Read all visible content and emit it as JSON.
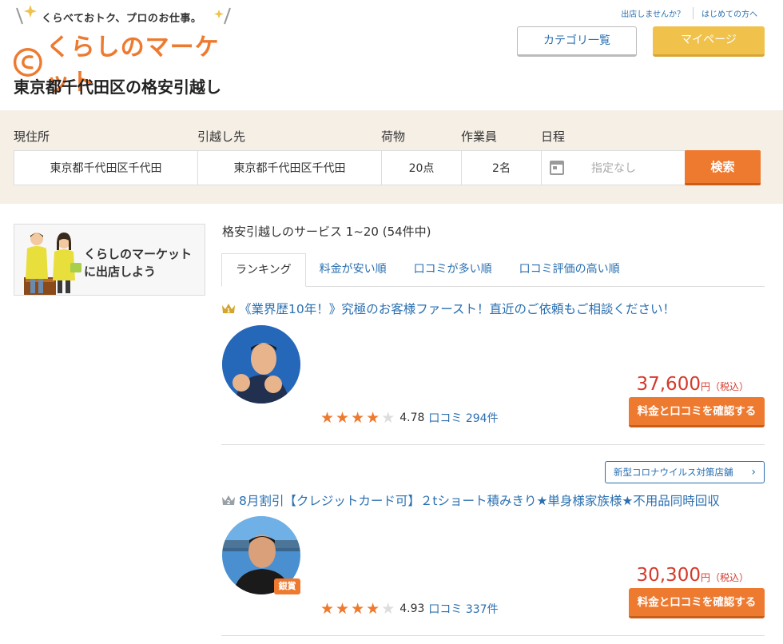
{
  "header": {
    "tagline": "くらべておトク、プロのお仕事。",
    "logo_text": "くらしのマーケット",
    "links": [
      "出店しませんか？",
      "はじめての方へ"
    ],
    "category_button": "カテゴリ一覧",
    "mypage_button": "マイページ",
    "page_title": "東京都千代田区の格安引越し",
    "brand_color": "#ee7a30"
  },
  "search": {
    "from_label": "現住所",
    "from_value": "東京都千代田区千代田",
    "to_label": "引越し先",
    "to_value": "東京都千代田区千代田",
    "items_label": "荷物",
    "items_value": "20点",
    "staff_label": "作業員",
    "staff_value": "2名",
    "date_label": "日程",
    "date_placeholder": "指定なし",
    "search_button": "検索"
  },
  "sidebar": {
    "banner_line1": "くらしのマーケット",
    "banner_line2": "に出店しよう"
  },
  "main": {
    "result_count": "格安引越しのサービス 1~20 (54件中)",
    "tabs": [
      "ランキング",
      "料金が安い順",
      "口コミが多い順",
      "口コミ評価の高い順"
    ],
    "listings": [
      {
        "title": "《業界歴10年！》究極のお客様ファースト！直近のご依頼もご相談ください！",
        "price": "37,600",
        "yen": "円",
        "tax": "（税込）",
        "button": "料金と口コミを確認する",
        "rating": 4.78,
        "score": "4.78",
        "reviews_label": "口コミ 294件"
      },
      {
        "covid_badge": "新型コロナウイルス対策店舗",
        "title": "8月割引【クレジットカード可】２tショート積みきり★単身様家族様★不用品同時回収",
        "award": "銀賞",
        "price": "30,300",
        "yen": "円",
        "tax": "（税込）",
        "button": "料金と口コミを確認する",
        "rating": 4.93,
        "score": "4.93",
        "reviews_label": "口コミ 337件"
      }
    ]
  }
}
